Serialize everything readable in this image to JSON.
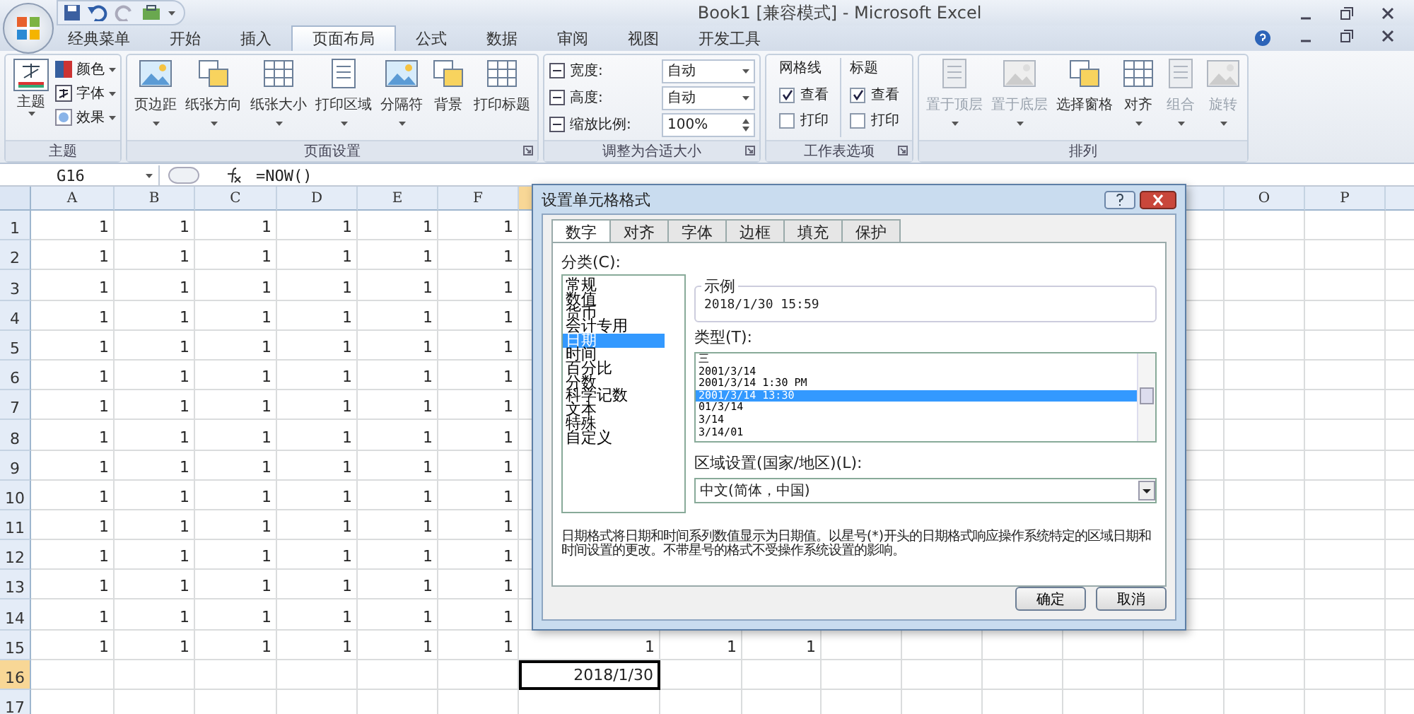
{
  "window": {
    "title": "Book1  [兼容模式] - Microsoft Excel"
  },
  "ribbon_tabs": [
    {
      "label": "经典菜单",
      "selected": false
    },
    {
      "label": "开始",
      "selected": false
    },
    {
      "label": "插入",
      "selected": false
    },
    {
      "label": "页面布局",
      "selected": true
    },
    {
      "label": "公式",
      "selected": false
    },
    {
      "label": "数据",
      "selected": false
    },
    {
      "label": "审阅",
      "selected": false
    },
    {
      "label": "视图",
      "selected": false
    },
    {
      "label": "开发工具",
      "selected": false
    }
  ],
  "ribbon_groups": [
    {
      "kind": "theme",
      "label": "主题",
      "launcher": false,
      "big": "主题",
      "items": [
        "颜色",
        "字体",
        "效果"
      ]
    },
    {
      "kind": "buttons",
      "label": "页面设置",
      "launcher": true,
      "buttons": [
        {
          "label": "页边距",
          "dropdown": true,
          "disabled": false
        },
        {
          "label": "纸张方向",
          "dropdown": true,
          "disabled": false
        },
        {
          "label": "纸张大小",
          "dropdown": true,
          "disabled": false
        },
        {
          "label": "打印区域",
          "dropdown": true,
          "disabled": false
        },
        {
          "label": "分隔符",
          "dropdown": true,
          "disabled": false
        },
        {
          "label": "背景",
          "dropdown": false,
          "disabled": false
        },
        {
          "label": "打印标题",
          "dropdown": false,
          "disabled": false
        }
      ]
    },
    {
      "kind": "size",
      "label": "调整为合适大小",
      "launcher": true,
      "fields": [
        {
          "label": "宽度:",
          "value": "自动",
          "kind": "dropdown"
        },
        {
          "label": "高度:",
          "value": "自动",
          "kind": "dropdown"
        },
        {
          "label": "缩放比例:",
          "value": "100%",
          "kind": "spinner"
        }
      ]
    },
    {
      "kind": "options",
      "label": "工作表选项",
      "launcher": true,
      "columns": [
        {
          "title": "网格线",
          "options": [
            {
              "label": "查看",
              "checked": true
            },
            {
              "label": "打印",
              "checked": false
            }
          ]
        },
        {
          "title": "标题",
          "options": [
            {
              "label": "查看",
              "checked": true
            },
            {
              "label": "打印",
              "checked": false
            }
          ]
        }
      ]
    },
    {
      "kind": "buttons",
      "label": "排列",
      "launcher": false,
      "buttons": [
        {
          "label": "置于顶层",
          "dropdown": true,
          "disabled": true
        },
        {
          "label": "置于底层",
          "dropdown": true,
          "disabled": true
        },
        {
          "label": "选择窗格",
          "dropdown": false,
          "disabled": false
        },
        {
          "label": "对齐",
          "dropdown": true,
          "disabled": false
        },
        {
          "label": "组合",
          "dropdown": true,
          "disabled": true
        },
        {
          "label": "旋转",
          "dropdown": true,
          "disabled": true
        }
      ]
    }
  ],
  "formula_bar": {
    "name_box": "G16",
    "formula": "=NOW()"
  },
  "sheet": {
    "columns": [
      {
        "label": "A"
      },
      {
        "label": "B"
      },
      {
        "label": "C"
      },
      {
        "label": "D"
      },
      {
        "label": "E"
      },
      {
        "label": "F"
      },
      {
        "selected": true
      },
      {},
      {},
      {},
      {},
      {},
      {},
      {},
      {
        "label": "O"
      },
      {
        "label": "P"
      }
    ],
    "rows": [
      {
        "label": "1",
        "selected": false,
        "cells": [
          "1",
          "1",
          "1",
          "1",
          "1",
          "1"
        ]
      },
      {
        "label": "2",
        "selected": false,
        "cells": [
          "1",
          "1",
          "1",
          "1",
          "1",
          "1"
        ]
      },
      {
        "label": "3",
        "selected": false,
        "cells": [
          "1",
          "1",
          "1",
          "1",
          "1",
          "1"
        ]
      },
      {
        "label": "4",
        "selected": false,
        "cells": [
          "1",
          "1",
          "1",
          "1",
          "1",
          "1"
        ]
      },
      {
        "label": "5",
        "selected": false,
        "cells": [
          "1",
          "1",
          "1",
          "1",
          "1",
          "1"
        ]
      },
      {
        "label": "6",
        "selected": false,
        "cells": [
          "1",
          "1",
          "1",
          "1",
          "1",
          "1"
        ]
      },
      {
        "label": "7",
        "selected": false,
        "cells": [
          "1",
          "1",
          "1",
          "1",
          "1",
          "1"
        ]
      },
      {
        "label": "8",
        "selected": false,
        "cells": [
          "1",
          "1",
          "1",
          "1",
          "1",
          "1"
        ]
      },
      {
        "label": "9",
        "selected": false,
        "cells": [
          "1",
          "1",
          "1",
          "1",
          "1",
          "1"
        ]
      },
      {
        "label": "10",
        "selected": false,
        "cells": [
          "1",
          "1",
          "1",
          "1",
          "1",
          "1"
        ]
      },
      {
        "label": "11",
        "selected": false,
        "cells": [
          "1",
          "1",
          "1",
          "1",
          "1",
          "1"
        ]
      },
      {
        "label": "12",
        "selected": false,
        "cells": [
          "1",
          "1",
          "1",
          "1",
          "1",
          "1"
        ]
      },
      {
        "label": "13",
        "selected": false,
        "cells": [
          "1",
          "1",
          "1",
          "1",
          "1",
          "1"
        ]
      },
      {
        "label": "14",
        "selected": false,
        "cells": [
          "1",
          "1",
          "1",
          "1",
          "1",
          "1"
        ]
      },
      {
        "label": "15",
        "selected": false,
        "cells": [
          "1",
          "1",
          "1",
          "1",
          "1",
          "1",
          "1",
          "1",
          "1"
        ]
      },
      {
        "label": "16",
        "selected": true,
        "cells": [
          null,
          null,
          null,
          null,
          null,
          null,
          {
            "text": "2018/1/30",
            "selected": true
          }
        ]
      },
      {
        "label": "17",
        "selected": false,
        "cells": []
      }
    ]
  },
  "dialog": {
    "title": "设置单元格格式",
    "tabs": [
      {
        "label": "数字",
        "selected": true
      },
      {
        "label": "对齐",
        "selected": false
      },
      {
        "label": "字体",
        "selected": false
      },
      {
        "label": "边框",
        "selected": false
      },
      {
        "label": "填充",
        "selected": false
      },
      {
        "label": "保护",
        "selected": false
      }
    ],
    "category_label": "分类(C):",
    "categories": [
      {
        "label": "常规",
        "selected": false
      },
      {
        "label": "数值",
        "selected": false
      },
      {
        "label": "货币",
        "selected": false
      },
      {
        "label": "会计专用",
        "selected": false
      },
      {
        "label": "日期",
        "selected": true
      },
      {
        "label": "时间",
        "selected": false
      },
      {
        "label": "百分比",
        "selected": false
      },
      {
        "label": "分数",
        "selected": false
      },
      {
        "label": "科学记数",
        "selected": false
      },
      {
        "label": "文本",
        "selected": false
      },
      {
        "label": "特殊",
        "selected": false
      },
      {
        "label": "自定义",
        "selected": false
      }
    ],
    "sample_label": "示例",
    "sample": "2018/1/30 15:59",
    "type_label": "类型(T):",
    "types": [
      {
        "label": "三",
        "selected": false
      },
      {
        "label": "2001/3/14",
        "selected": false
      },
      {
        "label": "2001/3/14 1:30 PM",
        "selected": false
      },
      {
        "label": "2001/3/14 13:30",
        "selected": true
      },
      {
        "label": "01/3/14",
        "selected": false
      },
      {
        "label": "3/14",
        "selected": false
      },
      {
        "label": "3/14/01",
        "selected": false
      }
    ],
    "locale_label": "区域设置(国家/地区)(L):",
    "locale": "中文(简体，中国)",
    "description": "日期格式将日期和时间系列数值显示为日期值。以星号(*)开头的日期格式响应操作系统特定的区域日期和时间设置的更改。不带星号的格式不受操作系统设置的影响。",
    "buttons": [
      "确定",
      "取消"
    ]
  }
}
